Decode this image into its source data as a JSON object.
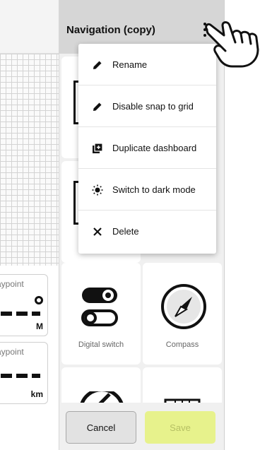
{
  "panel": {
    "title": "Navigation (copy)"
  },
  "menu": {
    "items": [
      {
        "label": "Rename",
        "icon": "pencil-icon"
      },
      {
        "label": "Disable snap to grid",
        "icon": "pencil-icon"
      },
      {
        "label": "Duplicate dashboard",
        "icon": "duplicate-icon"
      },
      {
        "label": "Switch to dark mode",
        "icon": "sun-icon"
      },
      {
        "label": "Delete",
        "icon": "close-icon"
      }
    ]
  },
  "widgets": {
    "digital_switch": "Digital switch",
    "compass": "Compass"
  },
  "canvas": {
    "card1": {
      "label": "aypoint",
      "unit": "M"
    },
    "card2": {
      "label": "aypoint",
      "unit": "km"
    }
  },
  "actions": {
    "cancel": "Cancel",
    "save": "Save"
  },
  "colors": {
    "save_bg": "#e7f28c",
    "header_bg": "#d6d6d6"
  }
}
